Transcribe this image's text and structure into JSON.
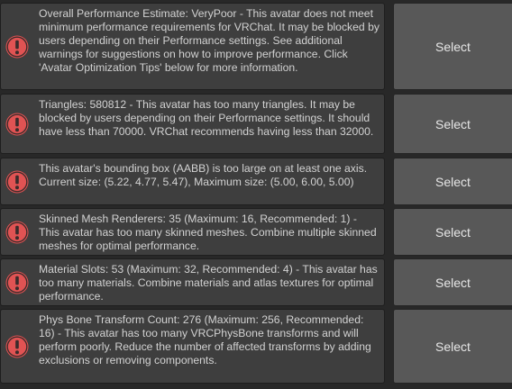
{
  "colors": {
    "error_icon": "#e05353",
    "message_bg": "#3e3e3e",
    "button_bg": "#585858",
    "panel_bg": "#282828"
  },
  "messages": [
    {
      "icon": "error-icon",
      "text": "Overall Performance Estimate: VeryPoor - This avatar does not meet minimum performance requirements for VRChat. It may be blocked by users depending on their Performance settings. See additional warnings for suggestions on how to improve performance. Click 'Avatar Optimization Tips' below for more information.",
      "button_label": "Select"
    },
    {
      "icon": "error-icon",
      "text": "Triangles: 580812 - This avatar has too many triangles. It may be blocked by users depending on their Performance settings. It should have less than 70000. VRChat recommends having less than 32000.",
      "button_label": "Select"
    },
    {
      "icon": "error-icon",
      "text": "This avatar's bounding box (AABB) is too large on at least one axis. Current size: (5.22, 4.77, 5.47), Maximum size: (5.00, 6.00, 5.00)",
      "button_label": "Select"
    },
    {
      "icon": "error-icon",
      "text": "Skinned Mesh Renderers: 35 (Maximum: 16, Recommended: 1) - This avatar has too many skinned meshes. Combine multiple skinned meshes for optimal performance.",
      "button_label": "Select"
    },
    {
      "icon": "error-icon",
      "text": "Material Slots: 53 (Maximum: 32, Recommended: 4) - This avatar has too many materials. Combine materials and atlas textures for optimal performance.",
      "button_label": "Select"
    },
    {
      "icon": "error-icon",
      "text": "Phys Bone Transform Count: 276 (Maximum: 256, Recommended: 16) - This avatar has too many VRCPhysBone transforms and will perform poorly. Reduce the number of affected transforms by adding exclusions or removing components.",
      "button_label": "Select"
    }
  ]
}
